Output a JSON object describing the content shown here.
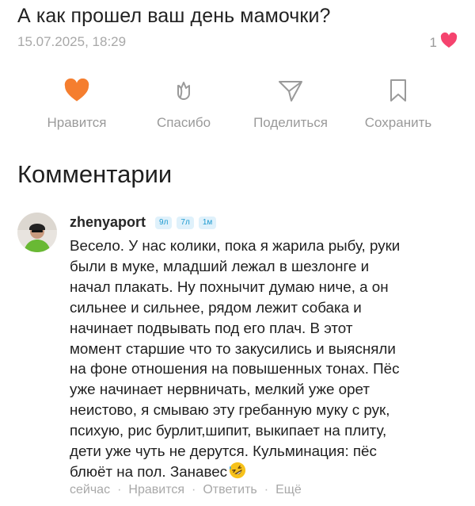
{
  "post": {
    "title": "А как прошел ваш день мамочки?",
    "date": "15.07.2025, 18:29",
    "likes_count": "1"
  },
  "actions": [
    {
      "label": "Нравится",
      "icon": "heart-filled-icon",
      "active": true
    },
    {
      "label": "Спасибо",
      "icon": "flower-icon"
    },
    {
      "label": "Поделиться",
      "icon": "send-icon"
    },
    {
      "label": "Сохранить",
      "icon": "bookmark-icon"
    }
  ],
  "comments": {
    "title": "Комментарии",
    "items": [
      {
        "username": "zhenyaport",
        "badges": [
          "9л",
          "7л",
          "1м"
        ],
        "text": "Весело. У нас колики, пока я жарила рыбу, руки\nбыли в муке, младший лежал в шезлонге и\nначал плакать. Ну похнычит думаю ниче, а он\nсильнее и сильнее, рядом лежит собака и\nначинает подвывать под его плач. В этот\nмомент старшие что то закусились и выясняли\nна фоне отношения на повышенных тонах. Пёс\nуже начинает нервничать, мелкий уже орет\nнеистово, я смываю эту гребанную муку с рук,\nпсихую, рис бурлит,шипит, выкипает на плиту,\nдети уже чуть не дерутся. Кульминация: пёс\nблюёт на пол. Занавес",
        "emoji": "rolling-on-floor-laughing",
        "footer": {
          "time": "сейчас",
          "like": "Нравится",
          "reply": "Ответить",
          "more": "Ещё"
        }
      }
    ]
  },
  "colors": {
    "accent": "#f57e2f",
    "heart_pink": "#f5436e",
    "badge_text": "#1e9ad0",
    "badge_bg": "#dff1fb",
    "muted": "#9a9a9a"
  }
}
